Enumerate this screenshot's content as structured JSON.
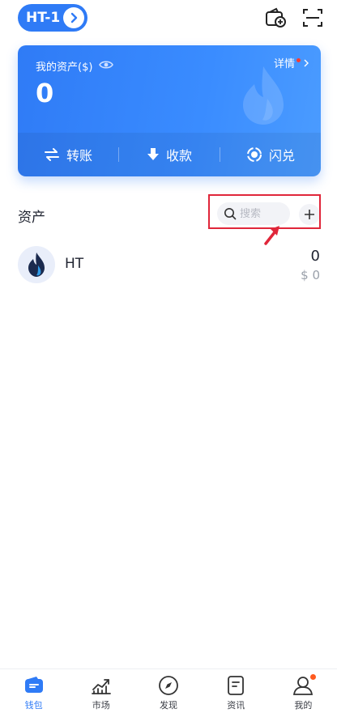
{
  "top_bar": {
    "network_label": "HT-1",
    "icons": [
      "add-wallet-icon",
      "scan-icon"
    ]
  },
  "card": {
    "asset_title": "我的资产($)",
    "asset_total": "0",
    "detail_label": "详情",
    "actions": [
      {
        "label": "转账",
        "icon": "transfer-icon"
      },
      {
        "label": "收款",
        "icon": "receive-icon"
      },
      {
        "label": "闪兑",
        "icon": "swap-icon"
      }
    ],
    "colors": {
      "gradient_start": "#2f7bf6",
      "gradient_end": "#4b9cff"
    }
  },
  "assets": {
    "title": "资产",
    "search_placeholder": "搜索",
    "add_icon": "plus-icon"
  },
  "tokens": [
    {
      "symbol": "HT",
      "amount": "0",
      "value": "$ 0",
      "icon": "ht-flame-icon"
    }
  ],
  "bottom_nav": {
    "items": [
      {
        "label": "钱包",
        "icon": "wallet-icon",
        "active": true
      },
      {
        "label": "市场",
        "icon": "market-icon",
        "active": false
      },
      {
        "label": "发现",
        "icon": "compass-icon",
        "active": false
      },
      {
        "label": "资讯",
        "icon": "news-icon",
        "active": false
      },
      {
        "label": "我的",
        "icon": "profile-icon",
        "active": false,
        "badge": true
      }
    ]
  },
  "colors": {
    "accent": "#2f7bf6",
    "highlight": "#e0263a",
    "badge": "#ff5a1f"
  }
}
